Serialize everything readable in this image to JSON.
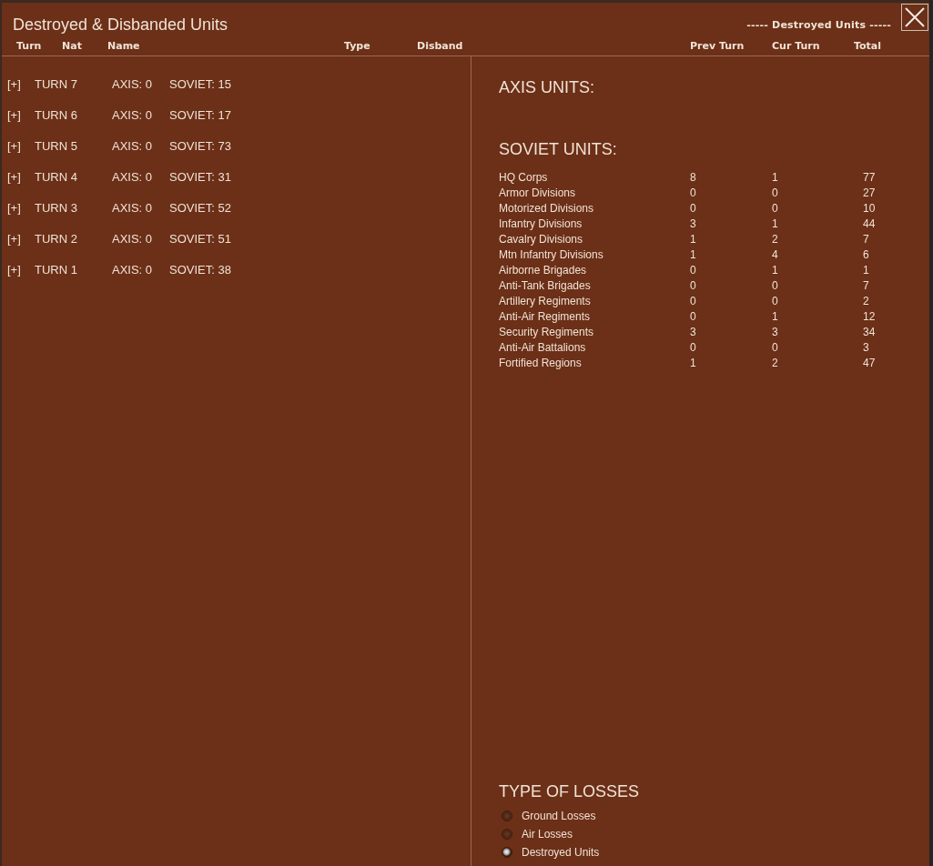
{
  "window": {
    "title": "Destroyed & Disbanded Units",
    "group_header": "----- Destroyed Units -----"
  },
  "columns": [
    "Turn",
    "Nat",
    "Name",
    "Type",
    "Disband",
    "Prev Turn",
    "Cur Turn",
    "Total"
  ],
  "turns": [
    {
      "toggle": "[+]",
      "label": "TURN 7",
      "axis": "AXIS: 0",
      "soviet": "SOVIET: 15"
    },
    {
      "toggle": "[+]",
      "label": "TURN 6",
      "axis": "AXIS: 0",
      "soviet": "SOVIET: 17"
    },
    {
      "toggle": "[+]",
      "label": "TURN 5",
      "axis": "AXIS: 0",
      "soviet": "SOVIET: 73"
    },
    {
      "toggle": "[+]",
      "label": "TURN 4",
      "axis": "AXIS: 0",
      "soviet": "SOVIET: 31"
    },
    {
      "toggle": "[+]",
      "label": "TURN 3",
      "axis": "AXIS: 0",
      "soviet": "SOVIET: 52"
    },
    {
      "toggle": "[+]",
      "label": "TURN 2",
      "axis": "AXIS: 0",
      "soviet": "SOVIET: 51"
    },
    {
      "toggle": "[+]",
      "label": "TURN 1",
      "axis": "AXIS: 0",
      "soviet": "SOVIET: 38"
    }
  ],
  "axis_units": {
    "title": "AXIS UNITS:"
  },
  "soviet_units": {
    "title": "SOVIET UNITS:",
    "rows": [
      {
        "name": "HQ Corps",
        "prev": "8",
        "cur": "1",
        "total": "77"
      },
      {
        "name": "Armor Divisions",
        "prev": "0",
        "cur": "0",
        "total": "27"
      },
      {
        "name": "Motorized Divisions",
        "prev": "0",
        "cur": "0",
        "total": "10"
      },
      {
        "name": "Infantry Divisions",
        "prev": "3",
        "cur": "1",
        "total": "44"
      },
      {
        "name": "Cavalry Divisions",
        "prev": "1",
        "cur": "2",
        "total": "7"
      },
      {
        "name": "Mtn Infantry Divisions",
        "prev": "1",
        "cur": "4",
        "total": "6"
      },
      {
        "name": "Airborne Brigades",
        "prev": "0",
        "cur": "1",
        "total": "1"
      },
      {
        "name": "Anti-Tank Brigades",
        "prev": "0",
        "cur": "0",
        "total": "7"
      },
      {
        "name": "Artillery Regiments",
        "prev": "0",
        "cur": "0",
        "total": "2"
      },
      {
        "name": "Anti-Air Regiments",
        "prev": "0",
        "cur": "1",
        "total": "12"
      },
      {
        "name": "Security Regiments",
        "prev": "3",
        "cur": "3",
        "total": "34"
      },
      {
        "name": "Anti-Air Battalions",
        "prev": "0",
        "cur": "0",
        "total": "3"
      },
      {
        "name": "Fortified Regions",
        "prev": "1",
        "cur": "2",
        "total": "47"
      }
    ]
  },
  "type_of_losses": {
    "title": "TYPE OF LOSSES",
    "options": [
      {
        "label": "Ground Losses",
        "selected": false
      },
      {
        "label": "Air Losses",
        "selected": false
      },
      {
        "label": "Destroyed Units",
        "selected": true
      }
    ]
  }
}
